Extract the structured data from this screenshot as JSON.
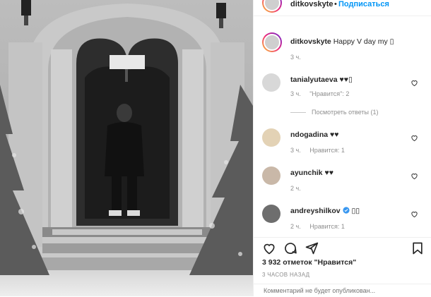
{
  "post": {
    "username": "ditkovskyte",
    "follow_label": "Подписаться",
    "dot": "•"
  },
  "caption": {
    "username": "ditkovskyte",
    "text": "Happy V day my ▯",
    "time": "3 ч."
  },
  "comments": [
    {
      "username": "tanialyutaeva",
      "text": "♥♥▯",
      "time": "3 ч.",
      "likes": "\"Нравится\": 2",
      "replies": "Посмотреть ответы (1)"
    },
    {
      "username": "ndogadina",
      "text": "♥♥",
      "time": "3 ч.",
      "likes": "Нравится: 1"
    },
    {
      "username": "ayunchik",
      "text": "♥♥",
      "time": "2 ч."
    },
    {
      "username": "andreyshilkov",
      "text": "▯▯",
      "time": "2 ч.",
      "likes": "Нравится: 1",
      "verified": true
    }
  ],
  "likes_count": "3 932 отметок \"Нравится\"",
  "posted_time": "3 ЧАСОВ НАЗАД",
  "add_comment_placeholder": "Комментарий не будет опубликован...",
  "colors": {
    "accent": "#0095f6",
    "muted": "#8e8e8e",
    "verified": "#3897f0"
  },
  "icons": [
    "like-icon",
    "comment-icon",
    "share-icon",
    "save-icon",
    "heart-icon",
    "verified-icon"
  ]
}
